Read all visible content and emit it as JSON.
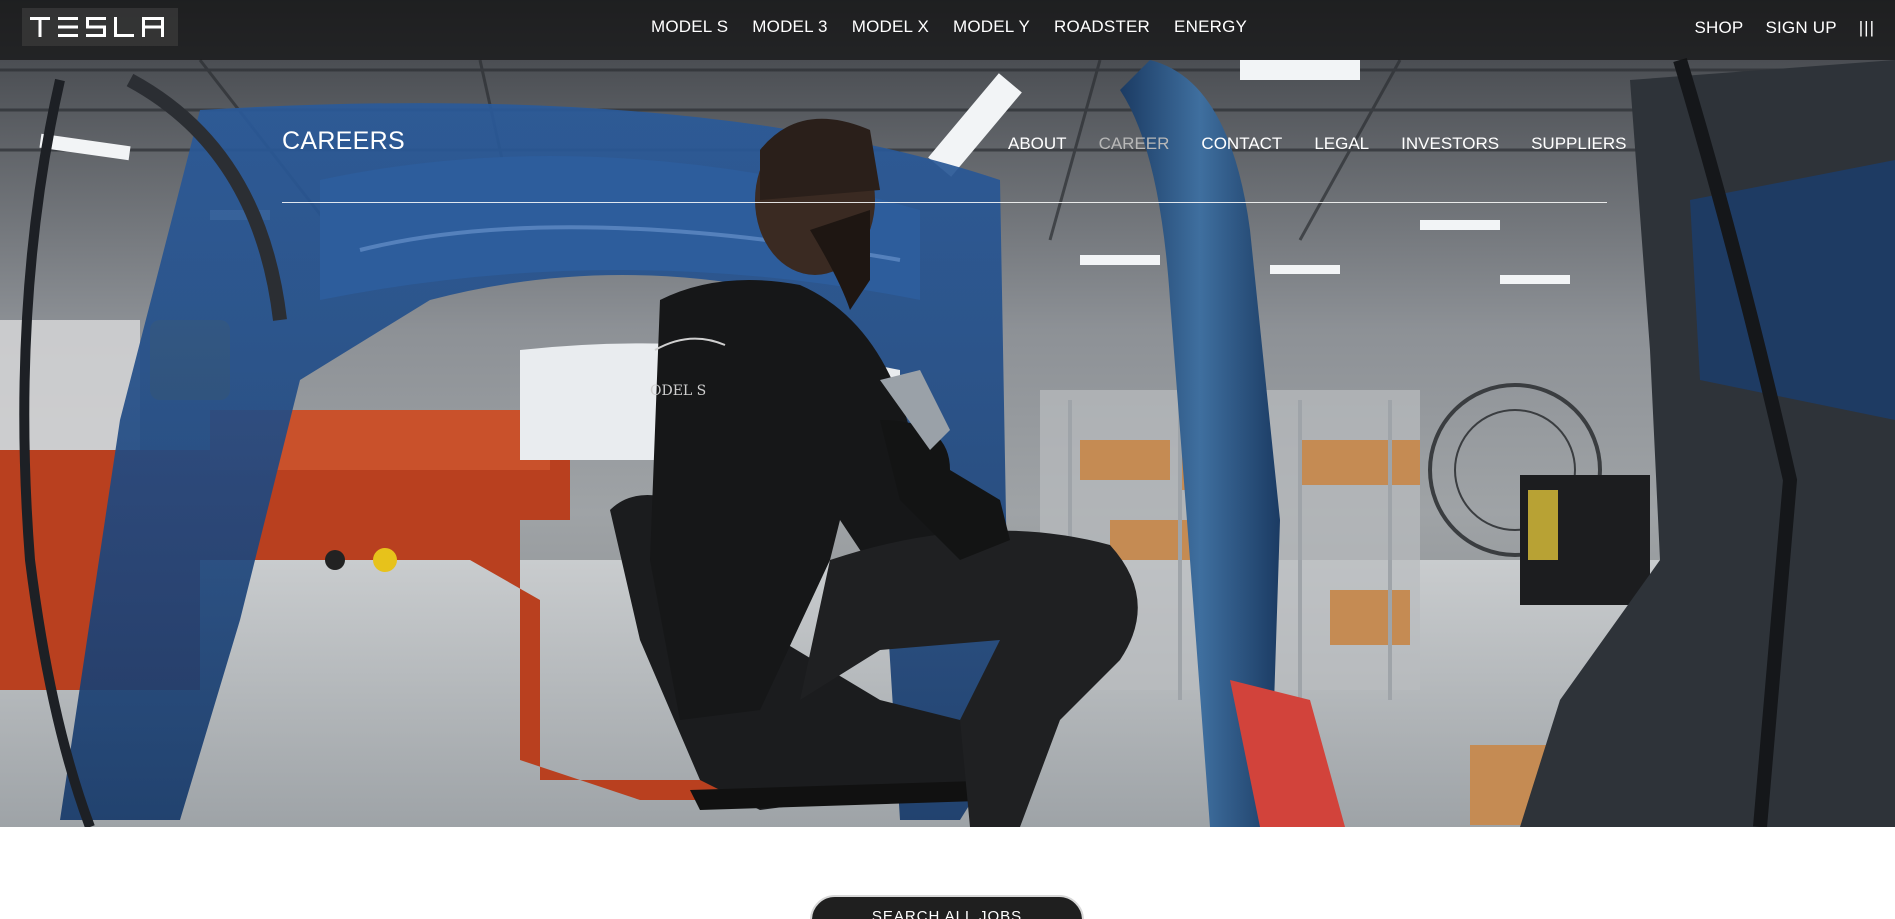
{
  "topnav": {
    "logo_text": "TESLA",
    "items": [
      "MODEL S",
      "MODEL 3",
      "MODEL X",
      "MODEL Y",
      "ROADSTER",
      "ENERGY"
    ],
    "right_items": [
      "SHOP",
      "SIGN UP"
    ],
    "menu_icon": "menu-icon"
  },
  "subnav": {
    "title": "CAREERS",
    "items": [
      "ABOUT",
      "CAREER",
      "CONTACT",
      "LEGAL",
      "INVESTORS",
      "SUPPLIERS"
    ],
    "active": "CAREER"
  },
  "main": {
    "search_button_label": "SEARCH ALL JOBS"
  },
  "colors": {
    "nav_bg": "#141414",
    "active_link": "#b8b8b8",
    "button_bg": "#1f1f1f"
  }
}
